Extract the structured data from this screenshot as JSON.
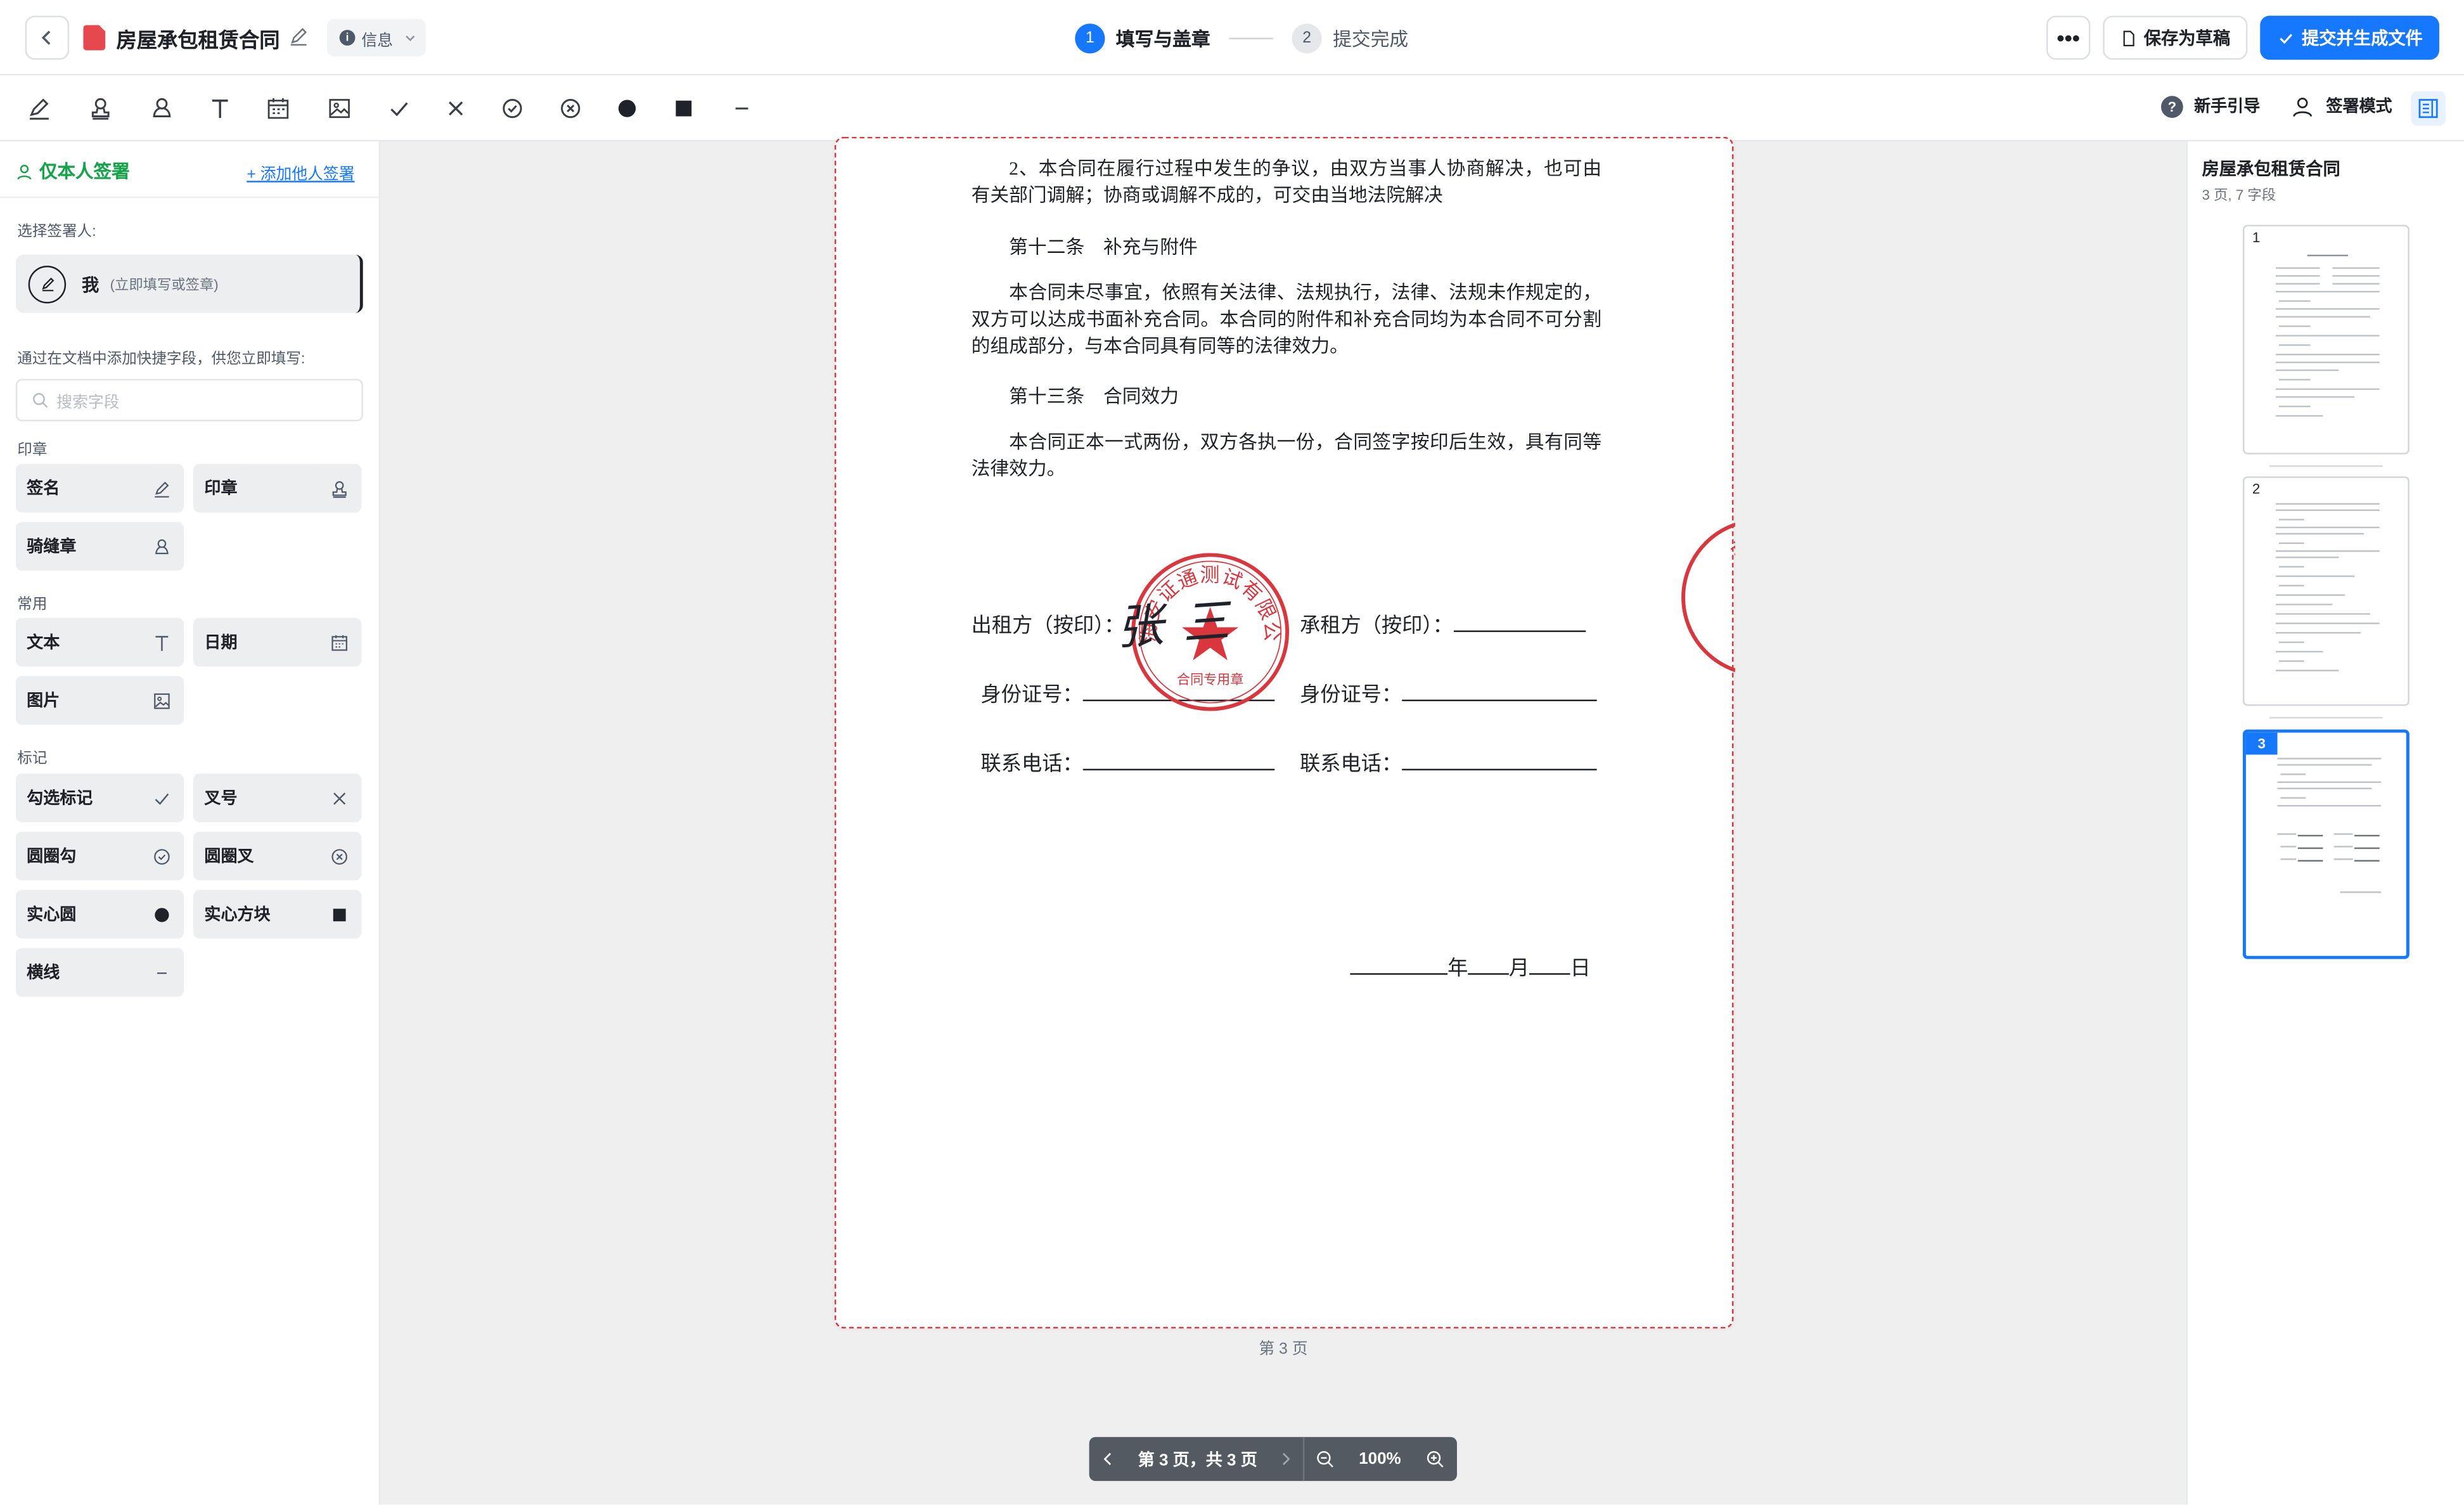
{
  "header": {
    "title": "房屋承包租赁合同",
    "info_label": "信息",
    "steps": [
      {
        "num": "1",
        "label": "填写与盖章"
      },
      {
        "num": "2",
        "label": "提交完成"
      }
    ],
    "more": "•••",
    "save_label": "保存为草稿",
    "submit_label": "提交并生成文件"
  },
  "toolbar": {
    "tools": [
      "signature-icon",
      "seal-icon",
      "seam-seal-icon",
      "text-icon",
      "calendar-icon",
      "image-icon",
      "check-icon",
      "cross-icon",
      "circle-check-icon",
      "circle-cross-icon",
      "filled-circle-icon",
      "filled-square-icon",
      "line-icon"
    ],
    "guide_label": "新手引导",
    "sign_mode_label": "签署模式"
  },
  "sidebar": {
    "mode_label": "仅本人签署",
    "add_signer": "+ 添加他人签署",
    "choose_signer_label": "选择签署人:",
    "signer_name": "我",
    "signer_desc": "(立即填写或签章)",
    "hint": "通过在文档中添加快捷字段，供您立即填写:",
    "search_placeholder": "搜索字段",
    "groups": {
      "seal": "印章",
      "common": "常用",
      "mark": "标记"
    },
    "fields": {
      "signature": "签名",
      "seal": "印章",
      "seam_seal": "骑缝章",
      "text": "文本",
      "date": "日期",
      "image": "图片",
      "check": "勾选标记",
      "cross": "叉号",
      "circle_check": "圆圈勾",
      "circle_cross": "圆圈叉",
      "solid_circle": "实心圆",
      "solid_square": "实心方块",
      "line": "横线"
    }
  },
  "document": {
    "para1": "2、本合同在履行过程中发生的争议，由双方当事人协商解决，也可由有关部门调解；协商或调解不成的，可交由当地法院解决",
    "article12_title": "第十二条　补充与附件",
    "para2": "本合同未尽事宜，依照有关法律、法规执行，法律、法规未作规定的，双方可以达成书面补充合同。本合同的附件和补充合同均为本合同不可分割的组成部分，与本合同具有同等的法律效力。",
    "article13_title": "第十三条　合同效力",
    "para3": "本合同正本一式两份，双方各执一份，合同签字按印后生效，具有同等法律效力。",
    "lessor_label": "出租方（按印）：",
    "lessee_label": "承租方（按印）：",
    "id_label": "身份证号：",
    "phone_label": "联系电话：",
    "year": "年",
    "month": "月",
    "day": "日",
    "signature_text": "张三",
    "seal_text": "上海安证通测试有限公司",
    "seal_bottom_text": "合同专用章",
    "seam_seal_text": "有限公司"
  },
  "canvas": {
    "page_label": "第 3 页",
    "pager_text": "第 3 页，共 3 页",
    "zoom": "100%"
  },
  "right_panel": {
    "title": "房屋承包租赁合同",
    "subtitle": "3 页, 7 字段",
    "thumbs": [
      "1",
      "2",
      "3"
    ]
  },
  "colors": {
    "primary": "#1677ff",
    "seal_red": "#d9363e",
    "success_green": "#16a34a"
  }
}
